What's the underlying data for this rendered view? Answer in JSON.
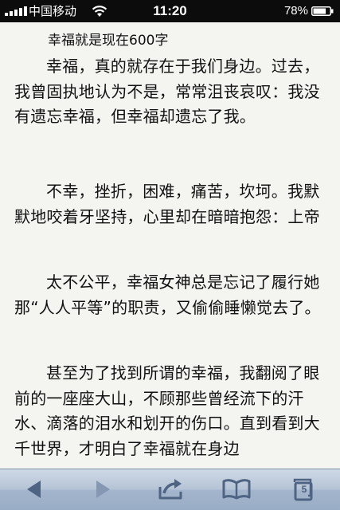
{
  "status_bar": {
    "carrier": "中国移动",
    "time": "11:20",
    "battery_percent": "78%",
    "battery_level": 0.78,
    "icons": [
      "signal-bars-icon",
      "wifi-icon",
      "battery-icon"
    ]
  },
  "article": {
    "title": "幸福就是现在600字",
    "paragraphs": [
      "幸福，真的就存在于我们身边。过去，我曾固执地认为不是，常常沮丧哀叹：我没有遗忘幸福，但幸福却遗忘了我。",
      "不幸，挫折，困难，痛苦，坎坷。我默默地咬着牙坚持，心里却在暗暗抱怨：上帝",
      "太不公平，幸福女神总是忘记了履行她那“人人平等”的职责，又偷偷睡懒觉去了。",
      "甚至为了找到所谓的幸福，我翻阅了眼前的一座座大山，不顾那些曾经流下的汗水、滴落的泪水和划开的伤口。直到看到大千世界，才明白了幸福就在身边"
    ]
  },
  "toolbar": {
    "buttons": [
      "back-arrow-icon",
      "forward-arrow-icon",
      "share-icon",
      "bookmarks-icon",
      "tabs-icon"
    ],
    "tab_count": "5",
    "colors": {
      "icon_active": "#4f6383",
      "icon_disabled": "#8597b3"
    }
  }
}
